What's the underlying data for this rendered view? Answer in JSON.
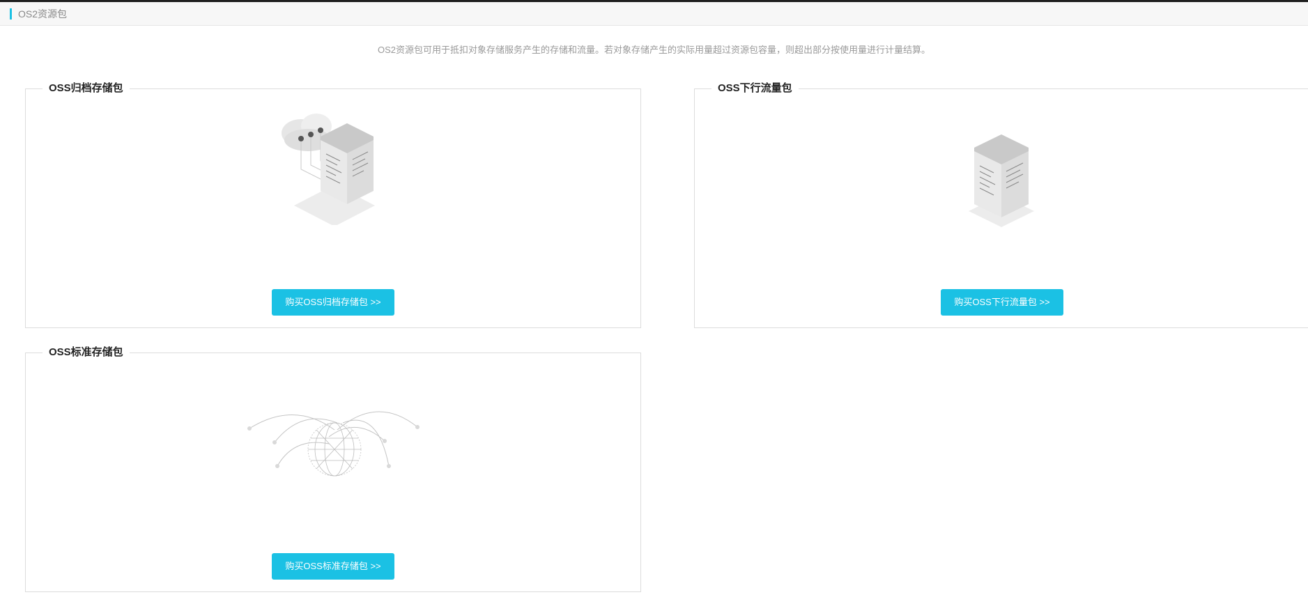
{
  "header": {
    "title": "OS2资源包"
  },
  "description": "OS2资源包可用于抵扣对象存储服务产生的存储和流量。若对象存储产生的实际用量超过资源包容量，则超出部分按使用量进行计量结算。",
  "cards": [
    {
      "title": "OSS归档存储包",
      "button": "购买OSS归档存储包 >>",
      "icon": "cloud-server-icon"
    },
    {
      "title": "OSS下行流量包",
      "button": "购买OSS下行流量包 >>",
      "icon": "server-icon"
    },
    {
      "title": "OSS标准存储包",
      "button": "购买OSS标准存储包 >>",
      "icon": "globe-network-icon"
    }
  ],
  "colors": {
    "accent": "#1bc1e4",
    "header_bg": "#f7f7f7",
    "border": "#dcdcdc"
  }
}
